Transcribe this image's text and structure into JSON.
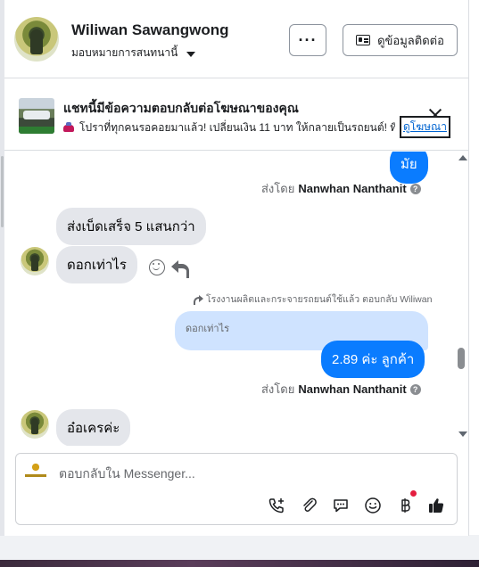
{
  "header": {
    "user_name": "Wiliwan Sawangwong",
    "assign_label": "มอบหมายการสนทนานี้",
    "more_label": "···",
    "contact_label": "ดูข้อมูลติดต่อ"
  },
  "ad": {
    "title": "แชทนี้มีข้อความตอบกลับต่อโฆษณาของคุณ",
    "subtitle": "โปราที่ทุกคนรอคอยมาแล้ว! เปลี่ยนเงิน 11 บาท ให้กลายเป็นรถยนต์! ที่ ...",
    "link_label": "ดูโฆษณา"
  },
  "messages": {
    "m1_text": "มัย",
    "sent_by_prefix": "ส่งโดย",
    "agent_name": "Nanwhan Nanthanit",
    "m2_text": "ส่งเบ็ดเสร็จ 5 แสนกว่า",
    "m3_text": "ดอกเท่าไร",
    "reply_context": "โรงงานผลิตและกระจายรถยนต์ใช้แล้ว ตอบกลับ Wiliwan",
    "quoted_text": "ดอกเท่าไร",
    "m4_text": "2.89 ค่ะ  ลูกค้า",
    "m5_text": "อ๋อเครค่ะ"
  },
  "composer": {
    "placeholder": "ตอบกลับใน Messenger..."
  },
  "icons": [
    "call-add-icon",
    "attachment-icon",
    "saved-reply-icon",
    "emoji-icon",
    "payment-icon",
    "like-icon"
  ],
  "colors": {
    "brand_blue": "#0a7cff",
    "incoming_bubble": "#e4e6eb",
    "quoted_bubble": "#cfe3ff"
  }
}
